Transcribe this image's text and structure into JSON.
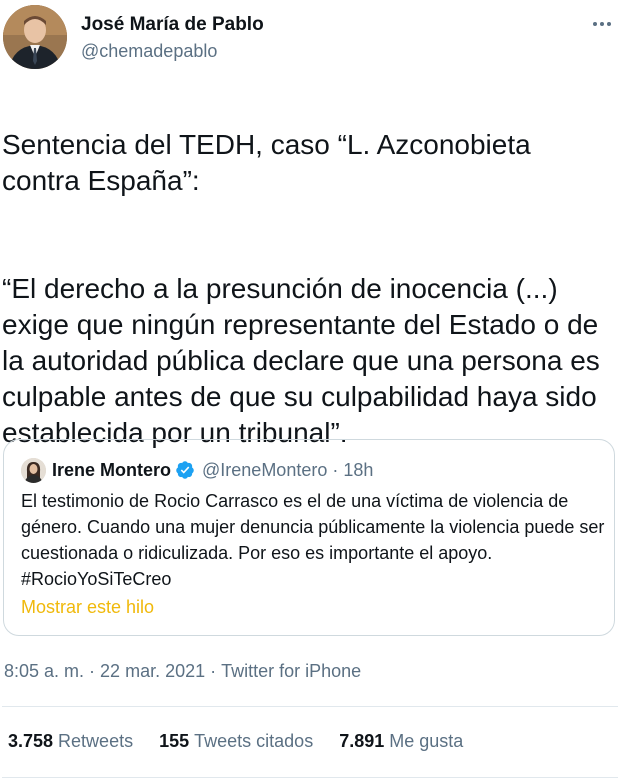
{
  "author": {
    "name": "José María de Pablo",
    "handle": "@chemadepablo"
  },
  "tweet": {
    "paragraphs": [
      "Sentencia del TEDH, caso “L. Azconobieta contra España”:",
      "“El derecho a la presunción de inocencia (...) exige que ningún representante del Estado o de la autoridad pública declare que una persona es culpable antes de que su culpabilidad haya sido establecida por un tribunal”."
    ]
  },
  "quoted_tweet": {
    "name": "Irene Montero",
    "verified": true,
    "handle": "@IreneMontero",
    "separator": "·",
    "time": "18h",
    "text": "El testimonio de Rocio Carrasco es el de una víctima de violencia de género. Cuando una mujer denuncia públicamente la violencia puede ser cuestionada o ridiculizada. Por eso es importante el apoyo. #RocioYoSiTeCreo",
    "show_thread_label": "Mostrar este hilo"
  },
  "meta": {
    "time": "8:05 a. m.",
    "separator": "·",
    "date": "22 mar. 2021",
    "source": "Twitter for iPhone"
  },
  "stats": {
    "retweets": {
      "count": "3.758",
      "label": "Retweets"
    },
    "quote_tweets": {
      "count": "155",
      "label": "Tweets citados"
    },
    "likes": {
      "count": "7.891",
      "label": "Me gusta"
    }
  },
  "icons": {
    "more": "more-horizontal-icon",
    "verified": "verified-badge-icon"
  },
  "colors": {
    "text": "#0f1419",
    "secondary": "#5b7083",
    "link": "#f0b90b",
    "verified": "#1da1f2",
    "border": "#cfd9de"
  }
}
